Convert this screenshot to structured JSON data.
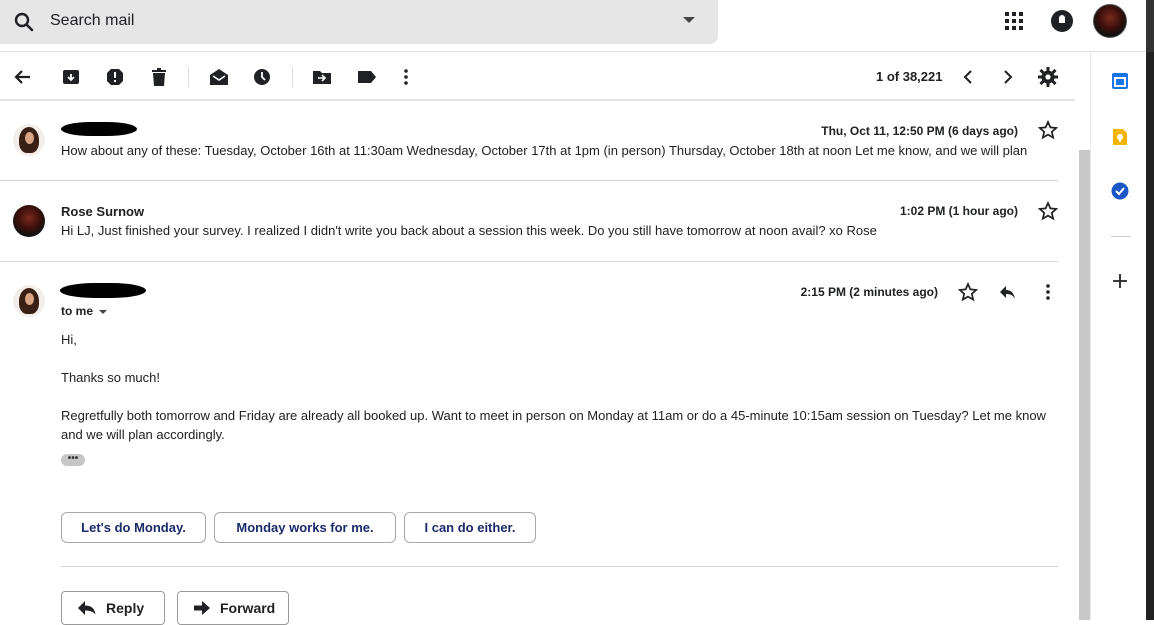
{
  "search": {
    "placeholder": "Search mail"
  },
  "toolbar": {
    "icons": [
      "back-arrow-icon",
      "archive-icon",
      "report-spam-icon",
      "delete-icon",
      "mark-unread-icon",
      "snooze-icon",
      "move-to-icon",
      "label-icon",
      "more-vert-icon"
    ],
    "page_count": "1 of 38,221"
  },
  "messages": [
    {
      "sender": "",
      "time": "Thu, Oct 11, 12:50 PM (6 days ago)",
      "snippet": "How about any of these: Tuesday, October 16th at 11:30am Wednesday, October 17th at 1pm (in person) Thursday, October 18th at noon Let me know, and we will plan"
    },
    {
      "sender": "Rose Surnow",
      "time": "1:02 PM (1 hour ago)",
      "snippet": "Hi LJ, Just finished your survey. I realized I didn't write you back about a session this week. Do you still have tomorrow at noon avail? xo Rose"
    },
    {
      "sender": "",
      "time": "2:15 PM (2 minutes ago)",
      "to_me": "to me",
      "body": [
        "Hi,",
        "Thanks so much!",
        "Regretfully both tomorrow and Friday are already all booked up. Want to meet in person on Monday at 11am or do a 45-minute 10:15am session on Tuesday? Let me know and we will plan accordingly."
      ],
      "trimmed": "•••"
    }
  ],
  "smart_replies": [
    "Let's do Monday.",
    "Monday works for me.",
    "I can do either."
  ],
  "actions": {
    "reply": "Reply",
    "forward": "Forward"
  },
  "right_panel": [
    "calendar-icon",
    "keep-icon",
    "tasks-icon",
    "add-icon"
  ],
  "colors": {
    "accent": "#1a73e8",
    "chip_text": "#1a2a6b",
    "keep": "#f4b400"
  }
}
